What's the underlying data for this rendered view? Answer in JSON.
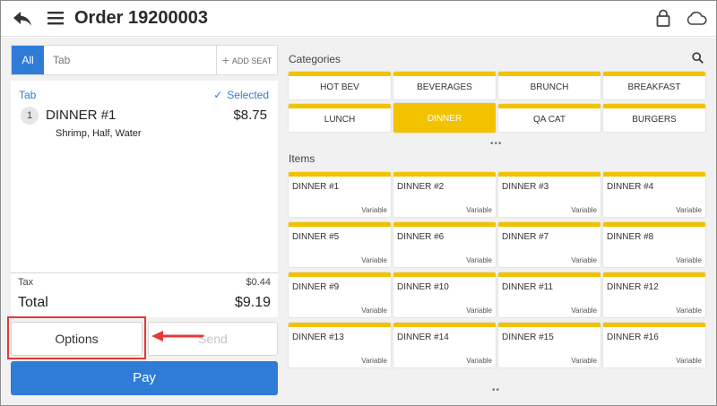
{
  "header": {
    "title": "Order 19200003",
    "icons": [
      "back-arrow-icon",
      "hamburger-menu-icon",
      "lock-icon",
      "cloud-icon"
    ]
  },
  "seats": {
    "all_label": "All",
    "tab_label": "Tab",
    "add_seat_label": "ADD SEAT"
  },
  "order": {
    "group_label": "Tab",
    "selected_label": "Selected",
    "items": [
      {
        "qty": "1",
        "name": "DINNER #1",
        "price": "$8.75",
        "modifiers": "Shrimp, Half, Water"
      }
    ],
    "tax_label": "Tax",
    "tax_value": "$0.44",
    "total_label": "Total",
    "total_value": "$9.19"
  },
  "actions": {
    "options_label": "Options",
    "send_label": "Send",
    "pay_label": "Pay"
  },
  "categories": {
    "label": "Categories",
    "items": [
      "HOT BEV",
      "BEVERAGES",
      "BRUNCH",
      "BREAKFAST",
      "LUNCH",
      "DINNER",
      "QA CAT",
      "BURGERS"
    ],
    "active": "DINNER"
  },
  "menu_items": {
    "label": "Items",
    "items": [
      {
        "name": "DINNER #1",
        "price": "Variable"
      },
      {
        "name": "DINNER #2",
        "price": "Variable"
      },
      {
        "name": "DINNER #3",
        "price": "Variable"
      },
      {
        "name": "DINNER #4",
        "price": "Variable"
      },
      {
        "name": "DINNER #5",
        "price": "Variable"
      },
      {
        "name": "DINNER #6",
        "price": "Variable"
      },
      {
        "name": "DINNER #7",
        "price": "Variable"
      },
      {
        "name": "DINNER #8",
        "price": "Variable"
      },
      {
        "name": "DINNER #9",
        "price": "Variable"
      },
      {
        "name": "DINNER #10",
        "price": "Variable"
      },
      {
        "name": "DINNER #11",
        "price": "Variable"
      },
      {
        "name": "DINNER #12",
        "price": "Variable"
      },
      {
        "name": "DINNER #13",
        "price": "Variable"
      },
      {
        "name": "DINNER #14",
        "price": "Variable"
      },
      {
        "name": "DINNER #15",
        "price": "Variable"
      },
      {
        "name": "DINNER #16",
        "price": "Variable"
      }
    ]
  },
  "colors": {
    "accent_blue": "#2e7cd6",
    "tile_yellow": "#f2c200",
    "annotation_red": "#e53935"
  }
}
